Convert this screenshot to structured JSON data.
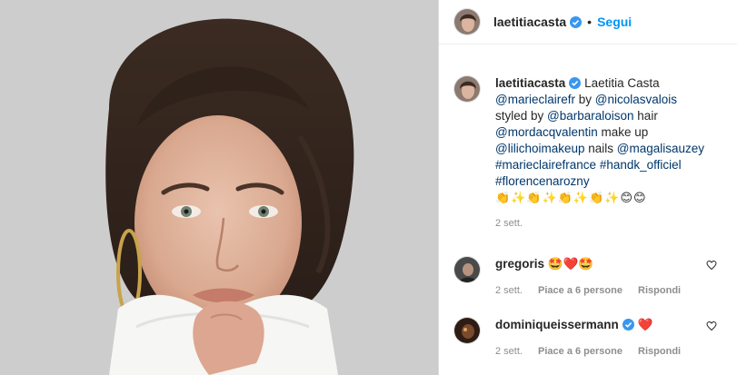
{
  "post": {
    "username": "laetitiacasta",
    "separator": "•",
    "follow_label": "Segui"
  },
  "caption": {
    "username": "laetitiacasta",
    "display_name": "Laetitia Casta",
    "mention_marieclaire": "@marieclairefr",
    "t_by": " by ",
    "mention_nicolas": "@nicolasvalois",
    "t_styled": " styled by ",
    "mention_barbara": "@barbaraloison",
    "t_hair": " hair ",
    "mention_mordacq": "@mordacqvalentin",
    "t_makeup": " make up ",
    "mention_lili": "@lilichoimakeup",
    "t_nails": " nails ",
    "mention_magali": "@magalisauzey",
    "hashtag_marieclaire": "#marieclairefrance",
    "hashtag_handk": "#handk_officiel",
    "hashtag_florence": "#florencenarozny",
    "emojis": "👏✨👏✨👏✨👏✨😊😊",
    "time": "2 sett."
  },
  "comments": [
    {
      "username": "gregoris",
      "text": "🤩❤️🤩",
      "time": "2 sett.",
      "likes": "Piace a 6 persone",
      "reply": "Rispondi"
    },
    {
      "username": "dominiqueissermann",
      "text": "❤️",
      "time": "2 sett.",
      "likes": "Piace a 6 persone",
      "reply": "Rispondi"
    }
  ],
  "colors": {
    "accent": "#0095f6",
    "verified": "#3897f0",
    "link": "#00376b",
    "muted": "#8e8e8e"
  },
  "icons": {
    "verified": "verified-badge-icon",
    "like": "heart-outline-icon"
  }
}
